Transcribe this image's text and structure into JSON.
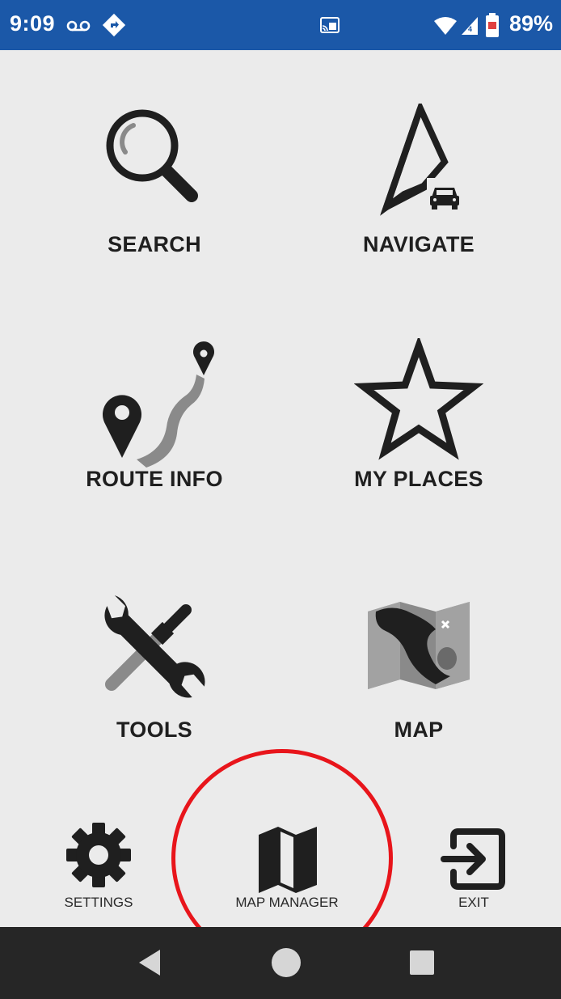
{
  "status_bar": {
    "time": "9:09",
    "battery_percent": "89%",
    "background_color": "#1b58a8",
    "icons": [
      "voicemail-icon",
      "navigation-app-icon",
      "cast-icon",
      "wifi-icon",
      "cell-signal-icon",
      "battery-icon"
    ]
  },
  "main_menu": {
    "items": [
      {
        "id": "search",
        "label": "SEARCH",
        "icon": "magnifier-icon"
      },
      {
        "id": "navigate",
        "label": "NAVIGATE",
        "icon": "navigation-arrow-car-icon"
      },
      {
        "id": "route_info",
        "label": "ROUTE INFO",
        "icon": "route-pins-icon"
      },
      {
        "id": "my_places",
        "label": "MY PLACES",
        "icon": "star-icon"
      },
      {
        "id": "tools",
        "label": "TOOLS",
        "icon": "wrench-screwdriver-icon"
      },
      {
        "id": "map",
        "label": "MAP",
        "icon": "folded-map-icon"
      }
    ]
  },
  "bottom_toolbar": {
    "items": [
      {
        "id": "settings",
        "label": "SETTINGS",
        "icon": "gear-icon"
      },
      {
        "id": "map_manager",
        "label": "MAP MANAGER",
        "icon": "map-outline-icon"
      },
      {
        "id": "exit",
        "label": "EXIT",
        "icon": "exit-icon"
      }
    ]
  },
  "annotation": {
    "highlighted_item": "map_manager",
    "color": "#e8151b"
  },
  "system_nav": {
    "buttons": [
      "back-icon",
      "home-icon",
      "recents-icon"
    ]
  }
}
